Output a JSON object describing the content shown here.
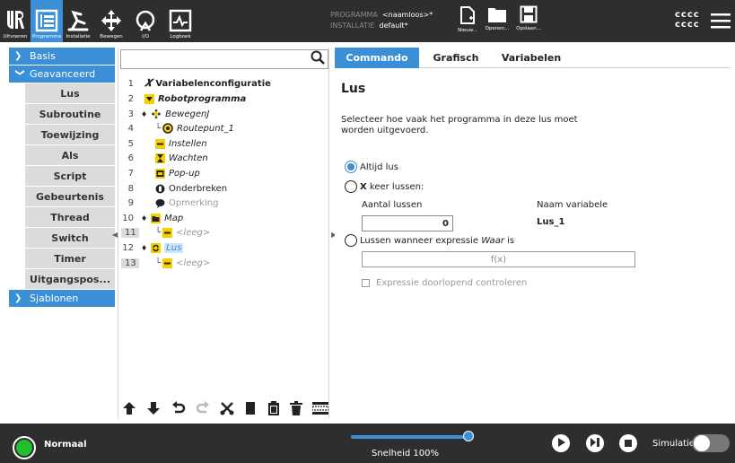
{
  "topbar": {
    "nav": [
      {
        "label": "Uitvoeren",
        "icon": "ur-logo-icon"
      },
      {
        "label": "Programma",
        "icon": "program-icon",
        "active": true
      },
      {
        "label": "Installatie",
        "icon": "installation-icon"
      },
      {
        "label": "Bewegen",
        "icon": "move-icon"
      },
      {
        "label": "I/O",
        "icon": "io-icon"
      },
      {
        "label": "Logboek",
        "icon": "log-icon"
      }
    ],
    "program_label": "PROGRAMMA",
    "program_value": "<naamloos>*",
    "installation_label": "INSTALLATIE",
    "installation_value": "default*",
    "file_buttons": [
      {
        "label": "Nieuw...",
        "icon": "new-file-icon"
      },
      {
        "label": "Openen...",
        "icon": "folder-icon"
      },
      {
        "label": "Opslaan...",
        "icon": "save-icon"
      }
    ],
    "user_line1": "cccc",
    "user_line2": "cccc"
  },
  "sidebar": {
    "categories": [
      {
        "label": "Basis",
        "expanded": false
      },
      {
        "label": "Geavanceerd",
        "expanded": true
      },
      {
        "label": "Sjablonen",
        "expanded": false
      }
    ],
    "items": [
      "Lus",
      "Subroutine",
      "Toewijzing",
      "Als",
      "Script",
      "Gebeurtenis",
      "Thread",
      "Switch",
      "Timer",
      "Uitgangspos..."
    ]
  },
  "tree": {
    "search_placeholder": "",
    "rows": [
      {
        "n": "1",
        "label": "Variabelenconfiguratie",
        "icon": "variable-x-icon"
      },
      {
        "n": "2",
        "label": "Robotprogramma",
        "icon": "program-flag-icon"
      },
      {
        "n": "3",
        "label": "BewegenJ",
        "icon": "move-icon"
      },
      {
        "n": "4",
        "label": "Routepunt_1",
        "icon": "waypoint-icon"
      },
      {
        "n": "5",
        "label": "Instellen",
        "icon": "set-icon"
      },
      {
        "n": "6",
        "label": "Wachten",
        "icon": "hourglass-icon"
      },
      {
        "n": "7",
        "label": "Pop-up",
        "icon": "popup-icon"
      },
      {
        "n": "8",
        "label": "Onderbreken",
        "icon": "halt-icon"
      },
      {
        "n": "9",
        "label": "Opmerking",
        "icon": "comment-icon"
      },
      {
        "n": "10",
        "label": "Map",
        "icon": "folder-icon"
      },
      {
        "n": "11",
        "label": "<leeg>",
        "icon": "empty-icon"
      },
      {
        "n": "12",
        "label": "Lus",
        "icon": "loop-icon"
      },
      {
        "n": "13",
        "label": "<leeg>",
        "icon": "empty-icon"
      }
    ],
    "toolbar": [
      "move-up-icon",
      "move-down-icon",
      "undo-icon",
      "redo-icon",
      "cut-icon",
      "copy-icon",
      "paste-icon",
      "delete-icon",
      "suppress-icon"
    ]
  },
  "panel": {
    "tabs": [
      "Commando",
      "Grafisch",
      "Variabelen"
    ],
    "title": "Lus",
    "description": "Selecteer hoe vaak het programma in deze lus moet worden uitgevoerd.",
    "opt_always": "Altijd lus",
    "opt_times_x": "X",
    "opt_times_rest": " keer lussen:",
    "count_label": "Aantal lussen",
    "count_value": "0",
    "varname_label": "Naam variabele",
    "varname_value": "Lus_1",
    "opt_expr_prefix": "Lussen wanneer expressie ",
    "opt_expr_italic": "Waar",
    "opt_expr_suffix": " is",
    "expr_placeholder": "f(x)",
    "continuous_check": "Expressie doorlopend controleren"
  },
  "bottombar": {
    "status": "Normaal",
    "speed_text": "Snelheid 100%",
    "speed_fraction": 1.0,
    "simulation": "Simulatie"
  },
  "colors": {
    "accent": "#3b8fd6",
    "bar": "#2e2e2e",
    "status_ok": "#1fbf2f",
    "tree_marker": "#f5d000"
  }
}
